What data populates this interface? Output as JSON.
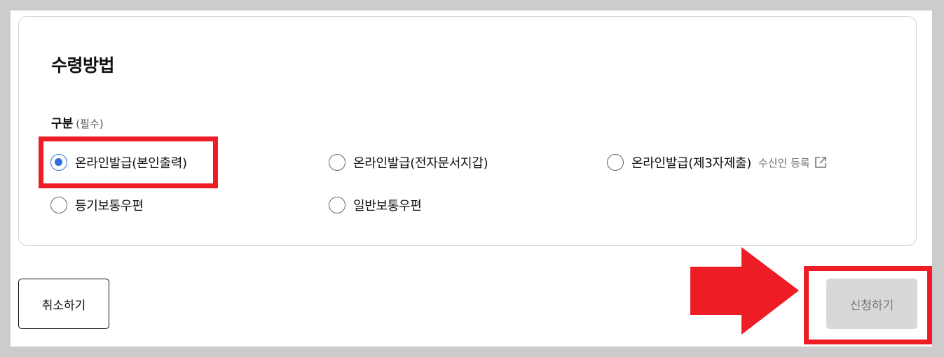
{
  "section": {
    "title": "수령방법"
  },
  "field": {
    "label": "구분",
    "required": "(필수)"
  },
  "options": [
    {
      "label": "온라인발급(본인출력)",
      "selected": true
    },
    {
      "label": "온라인발급(전자문서지갑)",
      "selected": false
    },
    {
      "label": "온라인발급(제3자제출)",
      "selected": false
    },
    {
      "label": "등기보통우편",
      "selected": false
    },
    {
      "label": "일반보통우편",
      "selected": false
    }
  ],
  "register_link": {
    "label": "수신인 등록",
    "icon": "external-link-icon"
  },
  "buttons": {
    "cancel": "취소하기",
    "submit": "신청하기"
  },
  "colors": {
    "accent": "#2f6fe0",
    "annotation": "#ee1c25",
    "disabled_bg": "#d8d8d8"
  }
}
